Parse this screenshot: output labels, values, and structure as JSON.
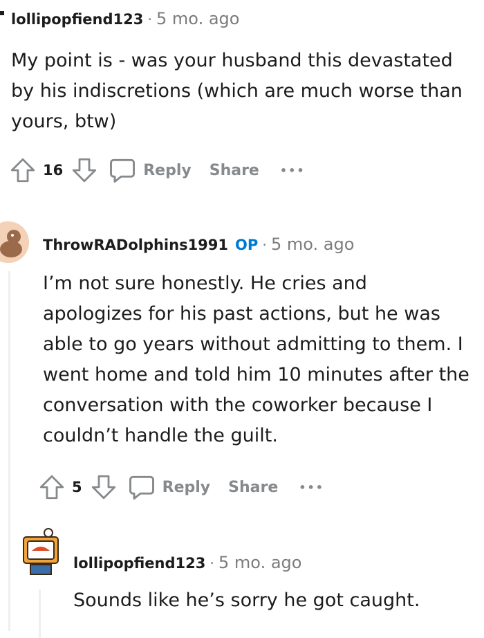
{
  "comments": [
    {
      "username": "lollipopfiend123",
      "time": "5 mo. ago",
      "text": "My point is - was your husband this devastated by his indiscretions (which are much worse than yours, btw)",
      "votes": "16",
      "reply_label": "Reply",
      "share_label": "Share",
      "more_label": "•••"
    },
    {
      "username": "ThrowRADolphins1991",
      "op_badge": "OP",
      "time": "5 mo. ago",
      "text": "I’m not sure honestly. He cries and apologizes for his past actions, but he was able to go years without admitting to them. I went home and told him 10 minutes after the conversation with the coworker because I couldn’t handle the guilt.",
      "votes": "5",
      "reply_label": "Reply",
      "share_label": "Share",
      "more_label": "•••"
    },
    {
      "username": "lollipopfiend123",
      "time": "5 mo. ago",
      "text": "Sounds like he’s sorry he got caught."
    }
  ],
  "separator": "·"
}
